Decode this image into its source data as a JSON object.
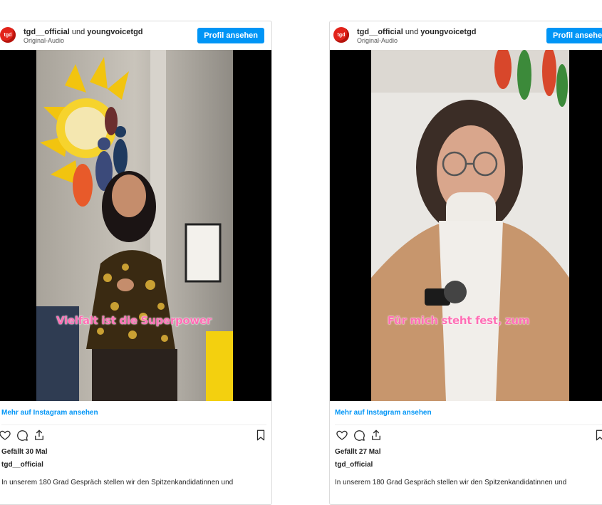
{
  "posts": [
    {
      "owner": "tgd__official",
      "connector": "und",
      "collaborator": "youngvoicetgd",
      "audio": "Original-Audio",
      "profile_button": "Profil ansehen",
      "avatar_text": "tgd",
      "caption": "Vielfalt ist die Superpower",
      "more_link": "Mehr auf Instagram ansehen",
      "likes": "Gefällt 30 Mal",
      "username": "tgd__official",
      "description": "In unserem 180 Grad Gespräch stellen wir den Spitzenkandidatinnen und"
    },
    {
      "owner": "tgd__official",
      "connector": "und",
      "collaborator": "youngvoicetgd",
      "audio": "Original-Audio",
      "profile_button": "Profil ansehen",
      "avatar_text": "tgd",
      "caption": "Für mich steht fest, zum",
      "more_link": "Mehr auf Instagram ansehen",
      "likes": "Gefällt 27 Mal",
      "username": "tgd_official",
      "description": "In unserem 180 Grad Gespräch stellen wir den Spitzenkandidatinnen und"
    }
  ],
  "icons": [
    "heart-icon",
    "comment-icon",
    "share-icon",
    "bookmark-icon"
  ],
  "colors": {
    "accent": "#0095f6",
    "caption": "#ff6fb5",
    "brand": "#e2231a"
  }
}
